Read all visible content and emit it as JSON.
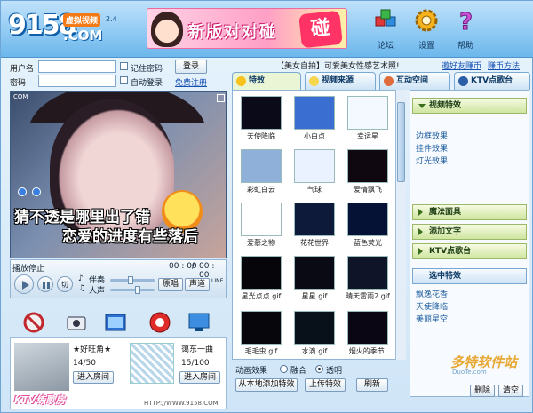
{
  "header": {
    "logo_num": "9158",
    "logo_name": "虚拟视频",
    "logo_version": "2.4",
    "logo_com": ".COM",
    "banner_text": "新版对对碰",
    "banner_burst": "碰",
    "buttons": [
      {
        "label": "论坛",
        "icon": "forum-icon"
      },
      {
        "label": "设置",
        "icon": "gear-icon"
      },
      {
        "label": "帮助",
        "icon": "help-icon"
      }
    ]
  },
  "login": {
    "username_label": "用户名",
    "password_label": "密码",
    "username_value": "",
    "password_value": "",
    "remember_label": "记住密码",
    "auto_login_label": "自动登录",
    "login_button": "登录",
    "register_link": "免费注册"
  },
  "notice": {
    "text": "【美女自拍】可爱美女性感艺术照!",
    "link1": "邀好友赚币",
    "link2": "赚币方法"
  },
  "tabs": [
    {
      "label": "特效",
      "active": true
    },
    {
      "label": "视频来源",
      "active": false
    },
    {
      "label": "互动空间",
      "active": false
    },
    {
      "label": "KTV点歌台",
      "active": false
    }
  ],
  "video": {
    "corner_label": "COM",
    "caption_line1": "猜不透是哪里出了错",
    "caption_line2": "恋爱的进度有些落后"
  },
  "player": {
    "status": "播放停止",
    "time_current": "00 : 00",
    "time_total": "00 : 00",
    "accompany_label": "伴奏",
    "voice_label": "人声",
    "stop_label": "切",
    "original_button": "原唱",
    "mono_button": "声道",
    "line_label": "LINE"
  },
  "users": [
    {
      "name": "★好旺角★",
      "count": "14/50",
      "enter_label": "进入房间"
    },
    {
      "name": "蔼东一曲",
      "count": "15/100",
      "enter_label": "进入房间"
    }
  ],
  "ktv_logo": "KTV练歌房",
  "site_url": "HTTP://WWW.9158.COM",
  "effects": [
    {
      "name": "天使降临",
      "color": "#0a0a18"
    },
    {
      "name": "小白点",
      "color": "#3a6fd1"
    },
    {
      "name": "幸运星",
      "color": "#f4f8ff"
    },
    {
      "name": "彩虹白云",
      "color": "#8fb0d8"
    },
    {
      "name": "气球",
      "color": "#eaf2ff"
    },
    {
      "name": "爱情飘飞",
      "color": "#100810"
    },
    {
      "name": "爱慕之物",
      "color": "#ffffff"
    },
    {
      "name": "花花世界",
      "color": "#0d1a3a"
    },
    {
      "name": "蓝色荧光",
      "color": "#051236"
    },
    {
      "name": "星光点点.gif",
      "color": "#05050a"
    },
    {
      "name": "星星.gif",
      "color": "#0a0a14"
    },
    {
      "name": "晴天雷雨2.gif",
      "color": "#101428"
    },
    {
      "name": "毛毛虫.gif",
      "color": "#06060c"
    },
    {
      "name": "水滴.gif",
      "color": "#08101a"
    },
    {
      "name": "烟火的季节.",
      "color": "#0a0614"
    }
  ],
  "effect_controls": {
    "label": "动画效果",
    "option_merge": "融合",
    "option_transparent": "透明",
    "add_local_button": "从本地添加特效",
    "upload_button": "上传特效",
    "refresh_button": "刷新"
  },
  "accordion": {
    "video_effects_header": "视频特效",
    "video_effects_items": [
      "边框效果",
      "挂件效果",
      "灯光效果"
    ],
    "magic_mask": "魔法面具",
    "add_text": "添加文字",
    "ktv": "KTV点歌台",
    "selected_header": "选中特效",
    "selected_items": [
      "飘逸花香",
      "天使降临",
      "美丽星空"
    ],
    "delete_button": "删除",
    "clear_button": "清空"
  },
  "watermark": "多特软件站",
  "watermark_sub": "DuoTe.com"
}
